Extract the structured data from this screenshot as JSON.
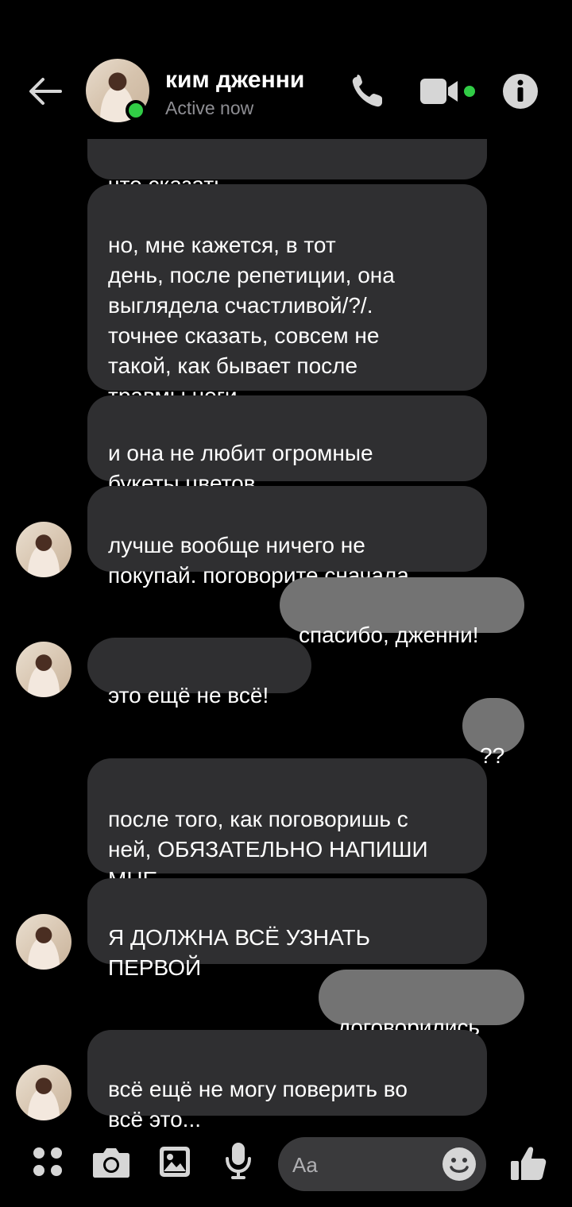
{
  "header": {
    "contact_name": "ким дженни",
    "status": "Active now"
  },
  "messages": [
    {
      "side": "in",
      "text": "что сказать"
    },
    {
      "side": "in",
      "text": "но, мне кажется, в тот\nдень, после репетиции, она\nвыглядела счастливой/?/.\nточнее сказать, совсем не\nтакой, как бывает после\nтравмы ноги..."
    },
    {
      "side": "in",
      "text": "и она не любит огромные\nбукеты цветов"
    },
    {
      "side": "in",
      "text": "лучше вообще ничего не\nпокупай. поговорите сначала"
    },
    {
      "side": "out",
      "text": "спасибо, дженни!"
    },
    {
      "side": "in",
      "text": "это ещё не всё!"
    },
    {
      "side": "out",
      "text": "??"
    },
    {
      "side": "in",
      "text": "после того, как поговоришь с\nней, ОБЯЗАТЕЛЬНО НАПИШИ\nМНЕ"
    },
    {
      "side": "in",
      "text": "Я ДОЛЖНА ВСЁ УЗНАТЬ\nПЕРВОЙ"
    },
    {
      "side": "out",
      "text": "договорились"
    },
    {
      "side": "in",
      "text": "всё ещё не могу поверить во\nвсё это..."
    }
  ],
  "composer": {
    "placeholder": "Aa"
  },
  "icons": {
    "back": "arrow-left-icon",
    "call": "phone-icon",
    "video": "video-camera-icon",
    "info": "info-icon",
    "apps": "grid-dots-icon",
    "camera": "camera-icon",
    "gallery": "image-icon",
    "mic": "microphone-icon",
    "emoji": "smiley-icon",
    "like": "thumbs-up-icon"
  },
  "colors": {
    "background": "#000000",
    "incoming_bubble": "#2f2f31",
    "outgoing_bubble": "#737373",
    "icon": "#d6d6d6",
    "active": "#31cc46"
  }
}
